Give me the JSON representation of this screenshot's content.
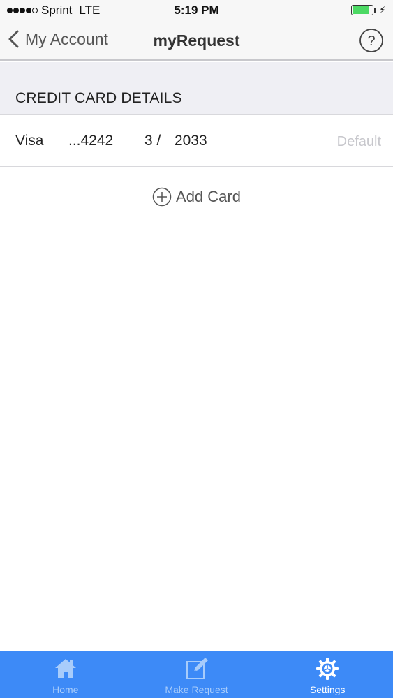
{
  "status_bar": {
    "carrier": "Sprint",
    "network": "LTE",
    "time": "5:19 PM",
    "signal_bars_filled": 4,
    "signal_bars_total": 5,
    "battery_level": 0.85,
    "battery_color": "#4cd964",
    "charging": true
  },
  "nav": {
    "back_label": "My Account",
    "title": "myRequest",
    "help_icon": "question-circle-icon"
  },
  "section": {
    "title": "CREDIT CARD DETAILS"
  },
  "cards": [
    {
      "brand": "Visa",
      "number": "...4242",
      "exp_month": "3 /",
      "exp_year": "2033",
      "status": "Default"
    }
  ],
  "add_card": {
    "label": "Add Card",
    "icon": "plus-circle-icon"
  },
  "tab_bar": {
    "background": "#3d8af7",
    "active_index": 2,
    "items": [
      {
        "label": "Home",
        "icon": "home-icon"
      },
      {
        "label": "Make Request",
        "icon": "edit-icon"
      },
      {
        "label": "Settings",
        "icon": "gear-icon"
      }
    ]
  }
}
